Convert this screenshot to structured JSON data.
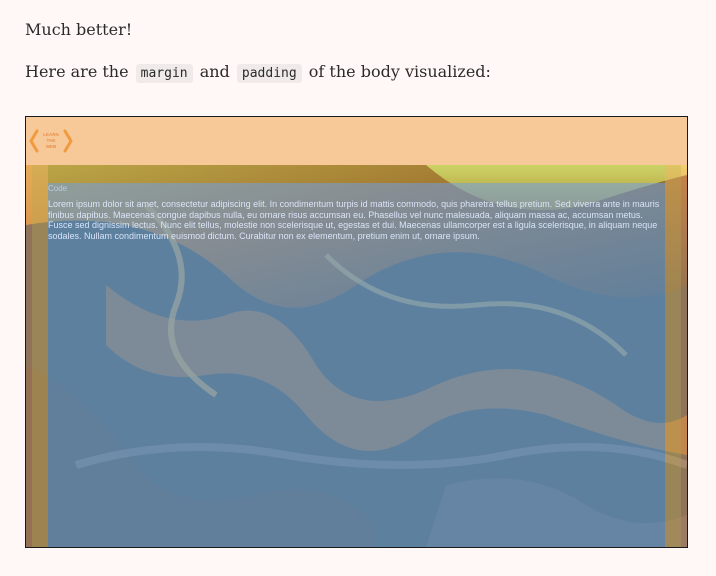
{
  "intro": {
    "text": "Much better!"
  },
  "sentence": {
    "before": "Here are the ",
    "code1": "margin",
    "middle": " and ",
    "code2": "padding",
    "after": " of the body visualized:"
  },
  "figure": {
    "logo_lines": [
      "LEARN",
      "THE",
      "WEB"
    ],
    "small_link": "Code",
    "lorem": "Lorem ipsum dolor sit amet, consectetur adipiscing elit. In condimentum turpis id mattis commodo, quis pharetra tellus pretium. Sed viverra ante in mauris finibus dapibus. Maecenas congue dapibus nulla, eu ornare risus accumsan eu. Phasellus vel nunc malesuada, aliquam massa ac, accumsan metus. Fusce sed dignissim lectus. Nunc elit tellus, molestie non scelerisque ut, egestas et dui. Maecenas ullamcorper est a ligula scelerisque, in aliquam neque sodales. Nullam condimentum euismod dictum. Curabitur non ex elementum, pretium enim ut, ornare ipsum."
  },
  "colors": {
    "page_background": "#fff8f6",
    "margin_overlay": "#f7c998",
    "padding_overlay": "#78aa3c",
    "content_overlay": "#6ea0eb",
    "logo_accent": "#f19a3e"
  }
}
